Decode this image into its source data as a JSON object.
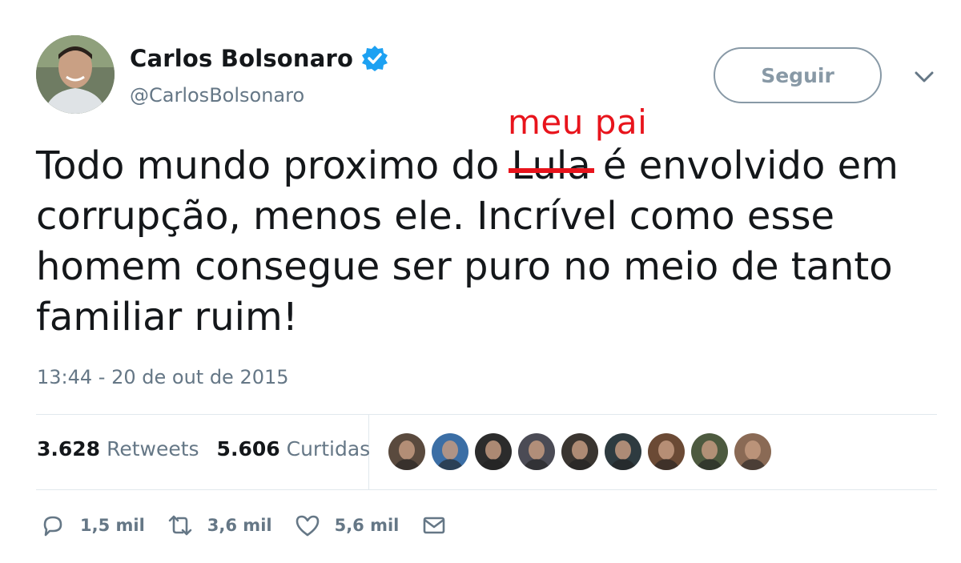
{
  "user": {
    "name": "Carlos Bolsonaro",
    "handle": "@CarlosBolsonaro",
    "follow_label": "Seguir"
  },
  "annotation": "meu pai",
  "tweet": {
    "text_before": "Todo mundo proximo do ",
    "struck_word": "Lula",
    "text_after": " é envolvido em corrupção, menos ele. Incrível como esse homem consegue ser puro no meio de tanto familiar ruim!",
    "timestamp": "13:44 - 20 de out de 2015"
  },
  "stats": {
    "retweets_count": "3.628",
    "retweets_label": "Retweets",
    "likes_count": "5.606",
    "likes_label": "Curtidas"
  },
  "actions": {
    "replies": "1,5 mil",
    "retweets": "3,6 mil",
    "likes": "5,6 mil"
  },
  "colors": {
    "annotation_red": "#e8141c",
    "verified_blue": "#1da1f2",
    "muted_gray": "#657786"
  },
  "liker_colors": [
    "#5a4a3e",
    "#3b6ea5",
    "#2c2c2c",
    "#4b4b55",
    "#3a3530",
    "#2e3b40",
    "#6b4a35",
    "#4d5a3f",
    "#8a6a55"
  ]
}
